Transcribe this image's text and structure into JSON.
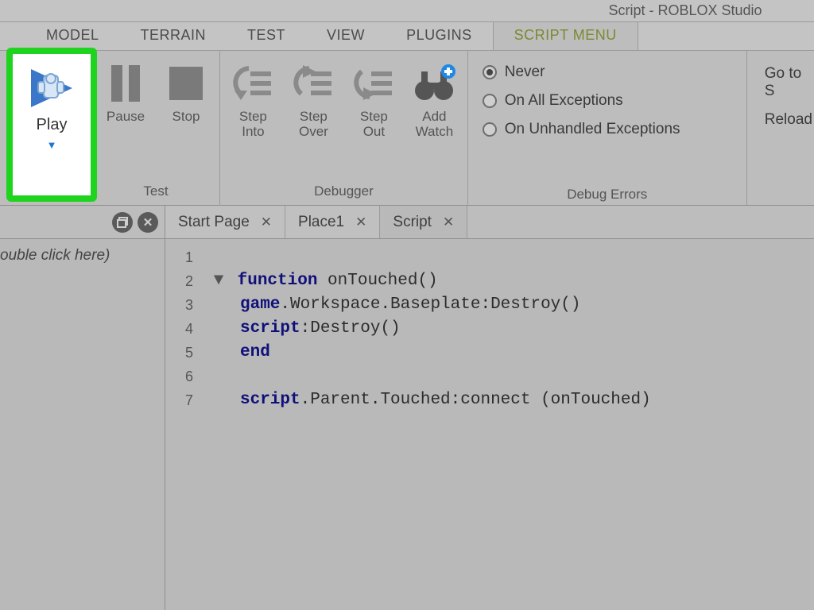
{
  "window": {
    "title": "Script - ROBLOX Studio"
  },
  "ribbon_tabs": {
    "model": "MODEL",
    "terrain": "TERRAIN",
    "test": "TEST",
    "view": "VIEW",
    "plugins": "PLUGINS",
    "script_menu": "SCRIPT MENU"
  },
  "ribbon": {
    "test_group": {
      "play": "Play",
      "pause": "Pause",
      "stop": "Stop",
      "caption": "Test"
    },
    "debugger_group": {
      "step_into": "Step\nInto",
      "step_over": "Step\nOver",
      "step_out": "Step\nOut",
      "add_watch": "Add\nWatch",
      "caption": "Debugger"
    },
    "debug_errors": {
      "never": "Never",
      "on_all": "On All Exceptions",
      "on_unhandled": "On Unhandled Exceptions",
      "caption": "Debug Errors"
    },
    "right": {
      "goto": "Go to S",
      "reload": "Reload"
    }
  },
  "sidebar": {
    "hint": "ouble click here)"
  },
  "doc_tabs": [
    {
      "label": "Start Page",
      "active": false
    },
    {
      "label": "Place1",
      "active": false
    },
    {
      "label": "Script",
      "active": true
    }
  ],
  "code": {
    "line1": "",
    "fn_kw": "function",
    "fn_name": " onTouched()",
    "game_kw": "game",
    "line3_rest": ".Workspace.Baseplate:Destroy()",
    "script_kw": "script",
    "line4_rest": ":Destroy()",
    "end_kw": "end",
    "line7_rest": ".Parent.Touched:connect (onTouched)"
  }
}
